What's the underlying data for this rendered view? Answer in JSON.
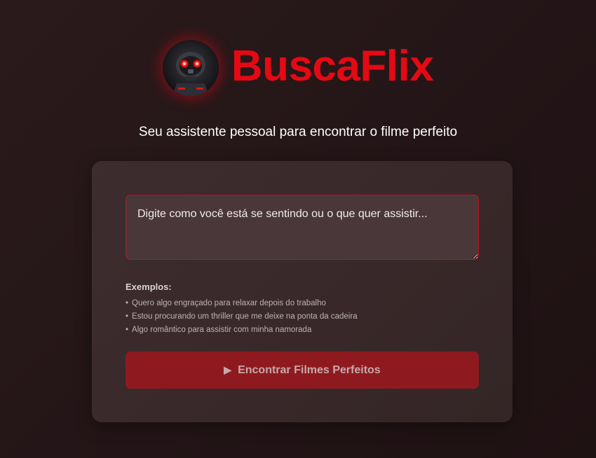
{
  "brand": {
    "name": "BuscaFlix",
    "logo_icon": "robot-avatar-icon",
    "accent_color": "#e50914"
  },
  "subtitle": "Seu assistente pessoal para encontrar o filme perfeito",
  "search": {
    "placeholder": "Digite como você está se sentindo ou o que quer assistir...",
    "value": ""
  },
  "examples": {
    "title": "Exemplos:",
    "bullet": "•",
    "items": [
      "Quero algo engraçado para relaxar depois do trabalho",
      "Estou procurando um thriller que me deixe na ponta da cadeira",
      "Algo romântico para assistir com minha namorada"
    ]
  },
  "submit": {
    "icon": "play-icon",
    "icon_glyph": "▶",
    "label": "Encontrar Filmes Perfeitos"
  }
}
